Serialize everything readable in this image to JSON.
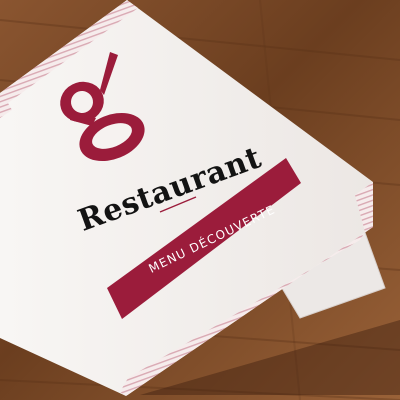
{
  "menu_card": {
    "logo_letter": "g",
    "brand": "Restaurant",
    "banner": "MENU DÉCOUVERTE"
  },
  "colors": {
    "table_wood": "#7a4a26",
    "card_paper": "#f6f2f0",
    "accent_burgundy": "#9b1c3b",
    "ink": "#131313"
  }
}
